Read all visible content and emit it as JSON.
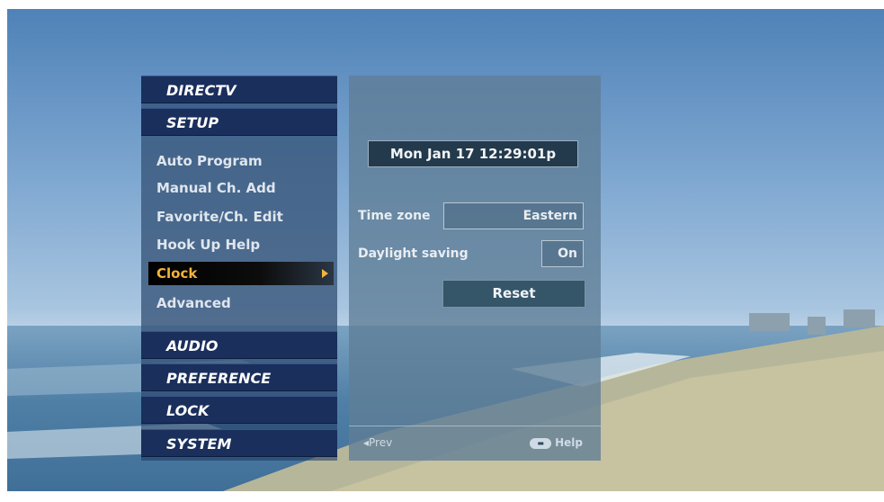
{
  "menu": {
    "title": "DIRECTV",
    "section": "SETUP",
    "items": [
      {
        "label": "Auto Program"
      },
      {
        "label": "Manual Ch. Add"
      },
      {
        "label": "Favorite/Ch. Edit"
      },
      {
        "label": "Hook Up Help"
      },
      {
        "label": "Clock",
        "selected": true
      },
      {
        "label": "Advanced"
      }
    ],
    "bottom": [
      "AUDIO",
      "PREFERENCE",
      "LOCK",
      "SYSTEM"
    ]
  },
  "panel": {
    "datetime": "Mon Jan 17 12:29:01p",
    "timezone_label": "Time zone",
    "timezone_value": "Eastern",
    "dst_label": "Daylight saving",
    "dst_value": "On",
    "reset_label": "Reset",
    "prev_label": "◂Prev",
    "help_label": "Help"
  },
  "colors": {
    "menu_header": "#1a2f5c",
    "selected_text": "#f2b43a",
    "panel": "#5f7d96"
  },
  "icons": [
    "arrow-right-icon",
    "menu-button-icon"
  ]
}
